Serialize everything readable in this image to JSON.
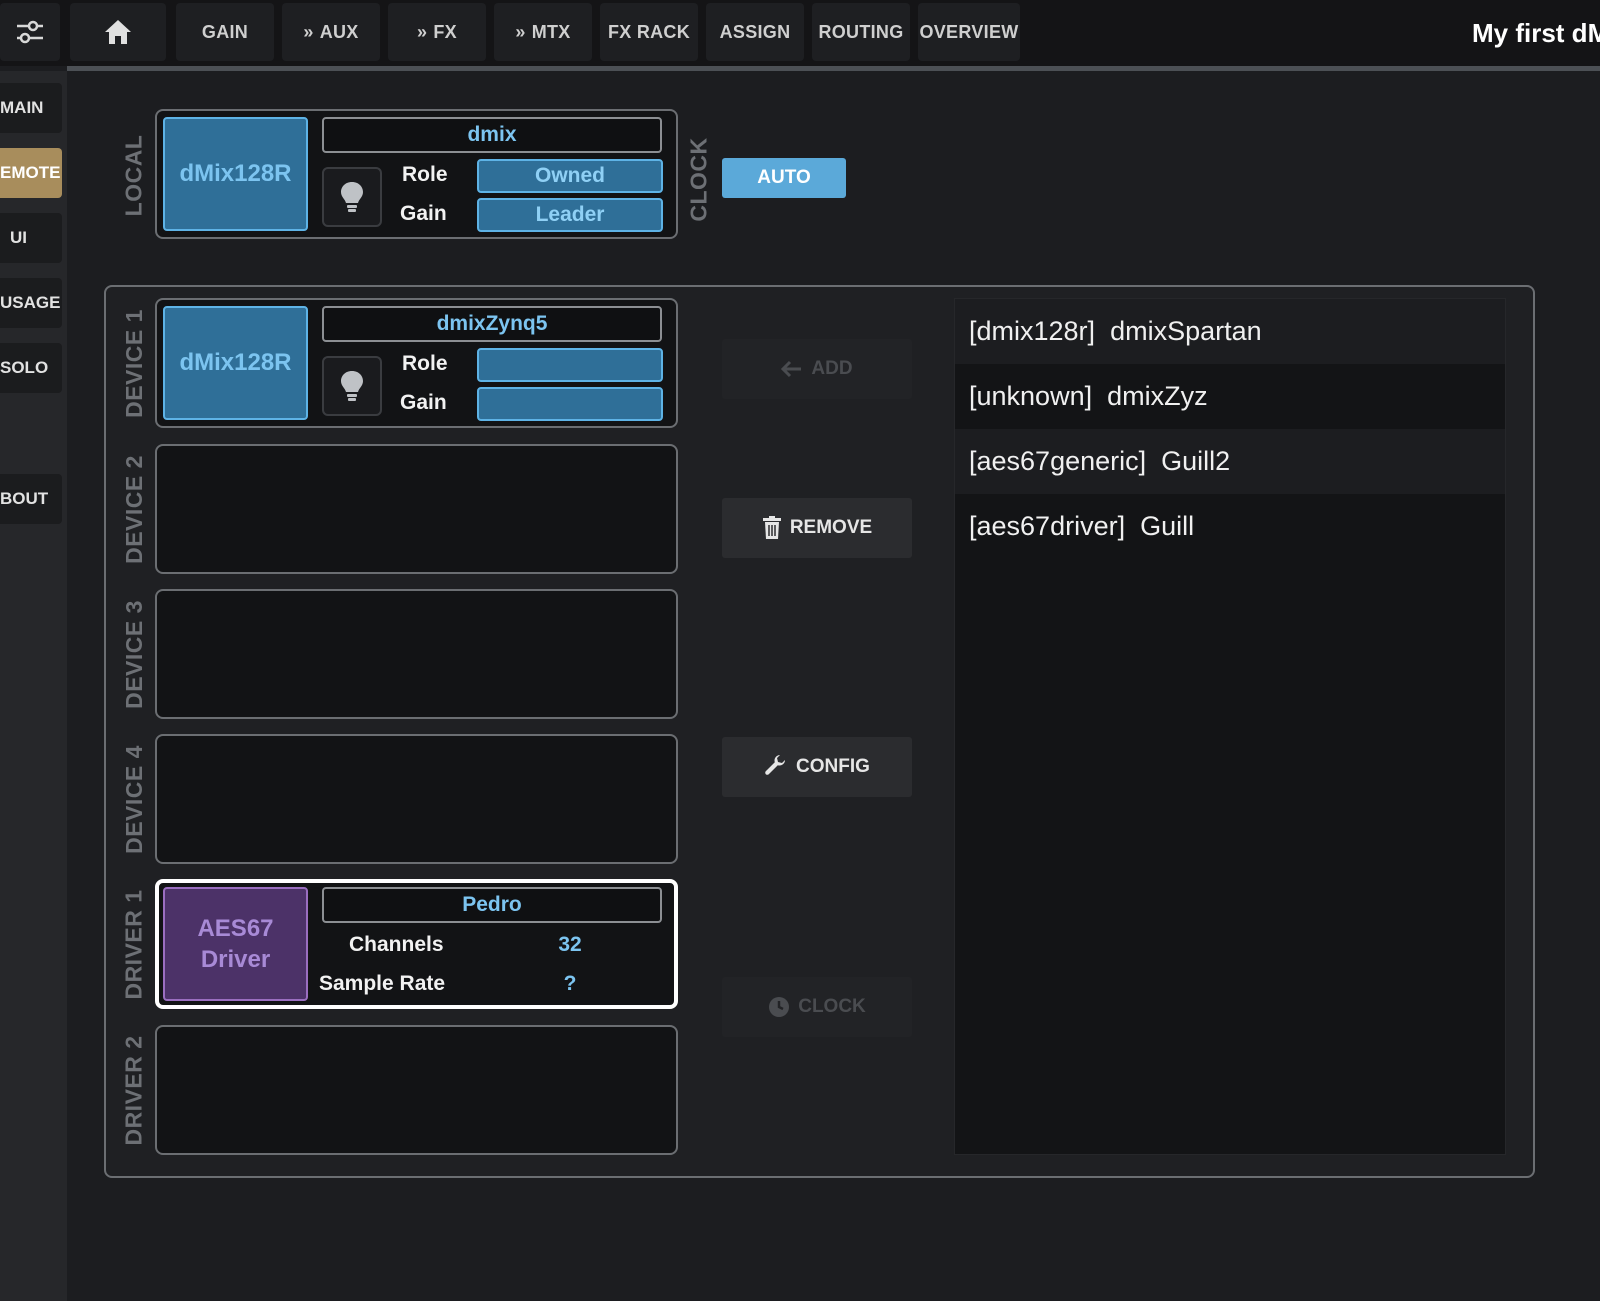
{
  "topbar": {
    "home_icon": "home-icon",
    "settings_icon": "sliders-icon",
    "tabs": [
      {
        "label": "GAIN",
        "chevron": false
      },
      {
        "label": "AUX",
        "chevron": true
      },
      {
        "label": "FX",
        "chevron": true
      },
      {
        "label": "MTX",
        "chevron": true
      },
      {
        "label": "FX RACK",
        "chevron": false
      },
      {
        "label": "ASSIGN",
        "chevron": false
      },
      {
        "label": "ROUTING",
        "chevron": false
      },
      {
        "label": "OVERVIEW",
        "chevron": false
      }
    ],
    "chevron_glyph": "»",
    "title": "My first dM"
  },
  "sidebar": {
    "items": [
      {
        "label": "MAIN"
      },
      {
        "label": "EMOTE",
        "active": true
      },
      {
        "label": "UI"
      },
      {
        "label": "USAGE"
      },
      {
        "label": "SOLO"
      },
      {
        "label": "BOUT"
      }
    ]
  },
  "local": {
    "section_label": "LOCAL",
    "device_type": "dMix128R",
    "name": "dmix",
    "role_label": "Role",
    "role_value": "Owned",
    "gain_label": "Gain",
    "gain_value": "Leader",
    "clock_label": "CLOCK",
    "clock_mode": "AUTO"
  },
  "slots": [
    {
      "label": "DEVICE 1",
      "device_type": "dMix128R",
      "name": "dmixZynq5",
      "role_label": "Role",
      "role_value": "",
      "gain_label": "Gain",
      "gain_value": ""
    },
    {
      "label": "DEVICE 2"
    },
    {
      "label": "DEVICE 3"
    },
    {
      "label": "DEVICE 4"
    },
    {
      "label": "DRIVER 1",
      "device_type_line1": "AES67",
      "device_type_line2": "Driver",
      "name": "Pedro",
      "channels_label": "Channels",
      "channels_value": "32",
      "sample_rate_label": "Sample Rate",
      "sample_rate_value": "?"
    },
    {
      "label": "DRIVER 2"
    }
  ],
  "actions": {
    "add": "ADD",
    "remove": "REMOVE",
    "config": "CONFIG",
    "clock": "CLOCK"
  },
  "discovered": [
    {
      "type": "[dmix128r]",
      "name": "dmixSpartan"
    },
    {
      "type": "[unknown]",
      "name": "dmixZyz"
    },
    {
      "type": "[aes67generic]",
      "name": "Guill2"
    },
    {
      "type": "[aes67driver]",
      "name": "Guill"
    }
  ],
  "colors": {
    "accent_blue": "#5eb3e6",
    "active_gold": "#a88d5c",
    "driver_purple": "#4c3268"
  }
}
